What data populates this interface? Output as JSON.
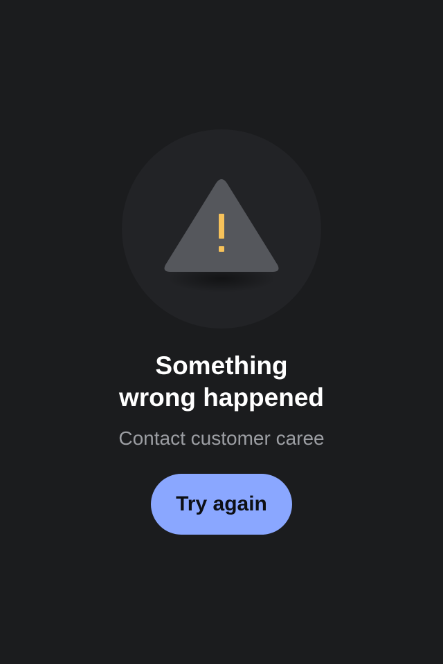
{
  "error": {
    "icon": "warning-icon",
    "title_line1": "Something",
    "title_line2": "wrong happened",
    "subtitle": "Contact customer caree",
    "button_label": "Try again"
  },
  "colors": {
    "background": "#1b1c1e",
    "icon_circle": "#222326",
    "triangle": "#55575c",
    "exclamation": "#f7c25a",
    "button": "#8aa7ff",
    "button_text": "#0d0f14",
    "title": "#ffffff",
    "subtitle": "#9c9ea3"
  }
}
